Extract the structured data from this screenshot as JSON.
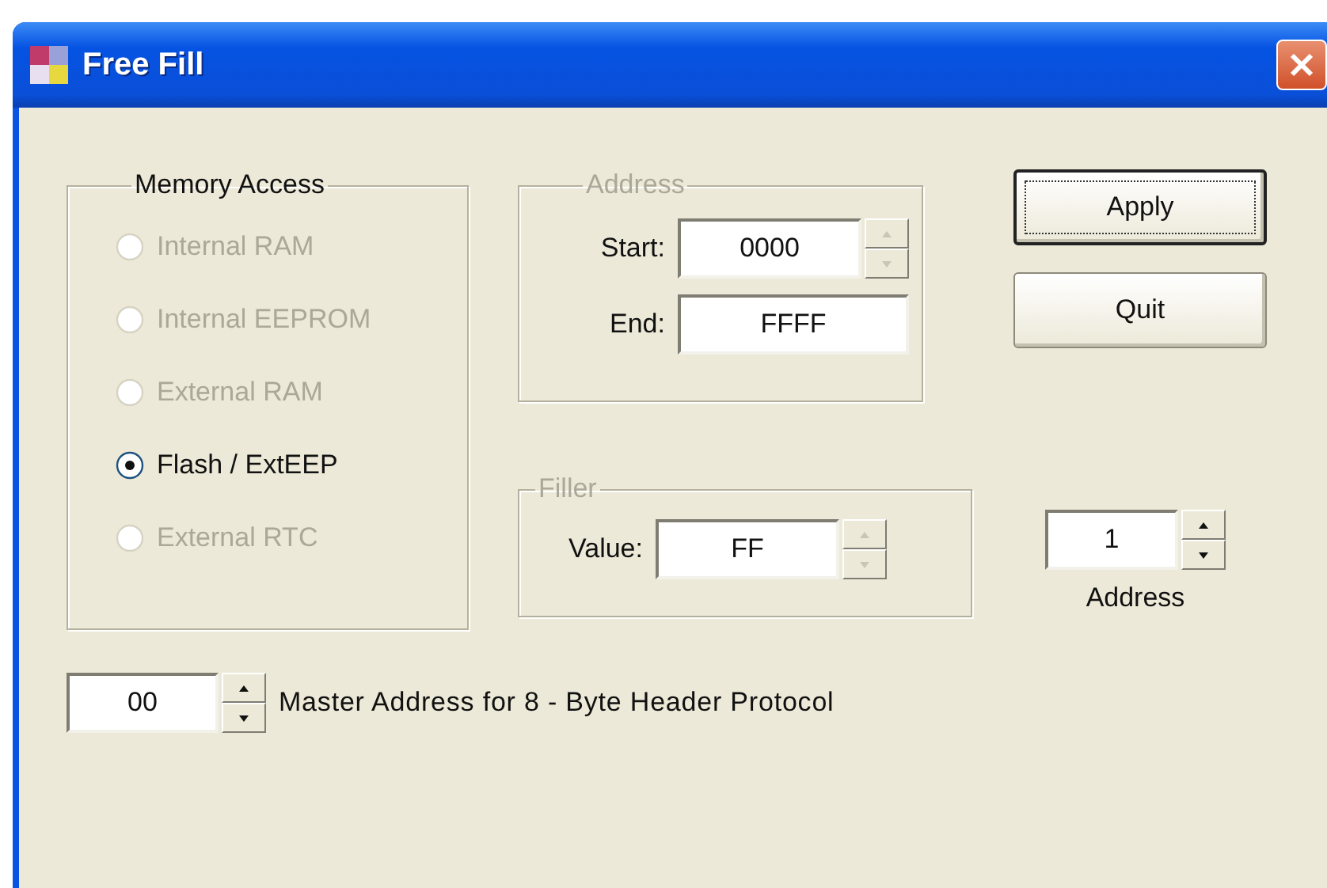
{
  "window": {
    "title": "Free Fill"
  },
  "memory_access": {
    "title": "Memory Access",
    "disabled": false,
    "options": [
      {
        "label": "Internal RAM",
        "selected": false,
        "disabled": true
      },
      {
        "label": "Internal EEPROM",
        "selected": false,
        "disabled": true
      },
      {
        "label": "External RAM",
        "selected": false,
        "disabled": true
      },
      {
        "label": "Flash / ExtEEP",
        "selected": true,
        "disabled": false
      },
      {
        "label": "External RTC",
        "selected": false,
        "disabled": true
      }
    ]
  },
  "address": {
    "title": "Address",
    "disabled": true,
    "start": {
      "label": "Start:",
      "value": "0000"
    },
    "end": {
      "label": "End:",
      "value": "FFFF"
    }
  },
  "filler": {
    "title": "Filler",
    "disabled": true,
    "value": {
      "label": "Value:",
      "value": "FF"
    }
  },
  "buttons": [
    {
      "label": "Apply",
      "default": true
    },
    {
      "label": "Quit",
      "default": false
    }
  ],
  "address_spinner": {
    "value": "1",
    "label": "Address"
  },
  "master_address": {
    "value": "00",
    "label": "Master Address for 8 - Byte Header Protocol"
  }
}
